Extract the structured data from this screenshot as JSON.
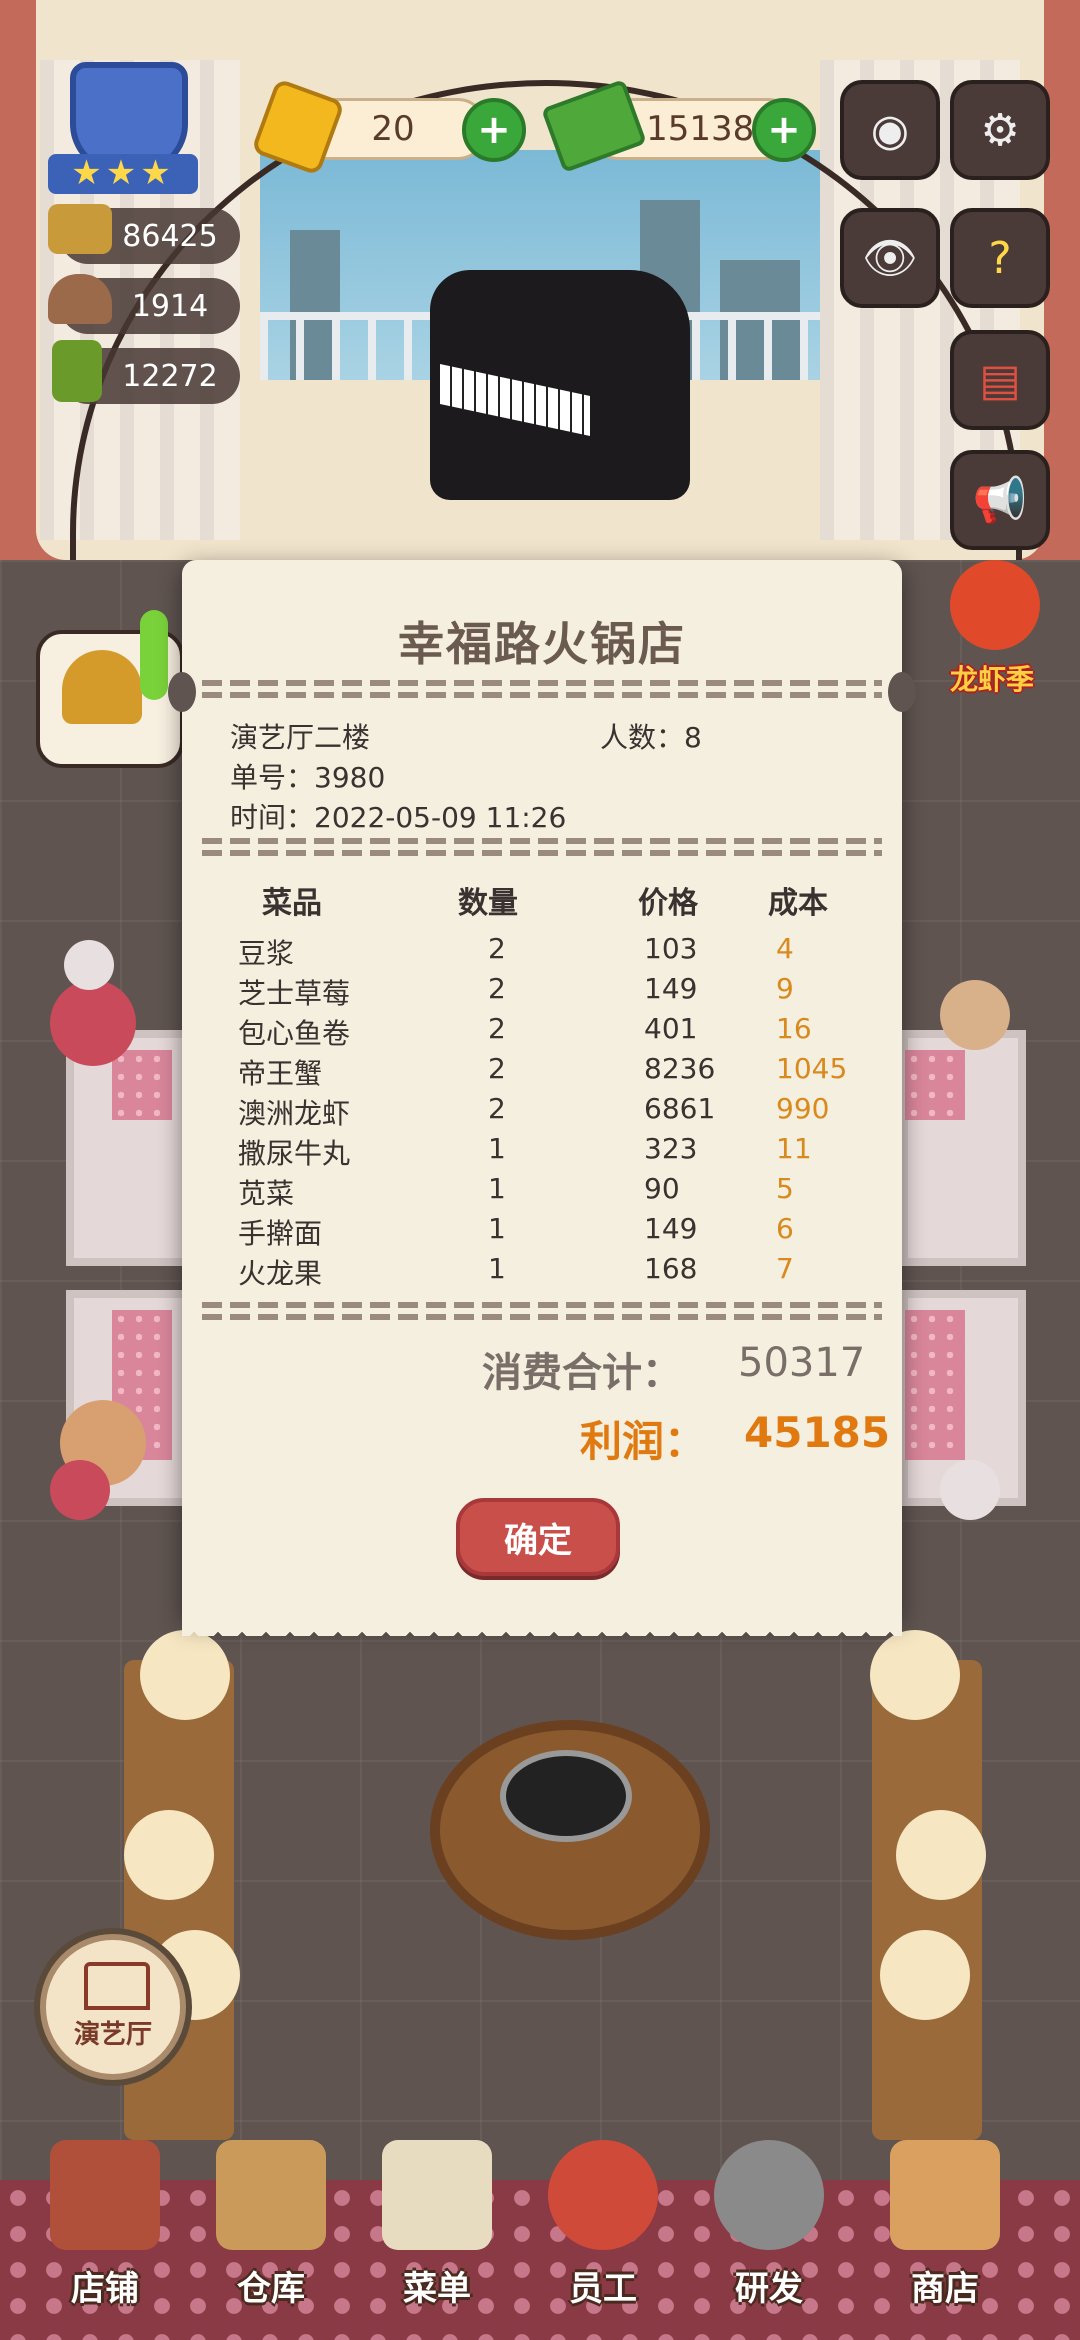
{
  "hud": {
    "gems": "20",
    "cash": "151382",
    "stat1": "86425",
    "stat2": "1914",
    "stat3": "12272",
    "stars": "★★★"
  },
  "side": {
    "event_label": "龙虾季"
  },
  "receipt": {
    "title": "幸福路火锅店",
    "hall": "演艺厅二楼",
    "people": "人数：8",
    "order_no": "单号：3980",
    "time": "时间：2022-05-09 11:26",
    "headers": {
      "name": "菜品",
      "qty": "数量",
      "price": "价格",
      "cost": "成本"
    },
    "items": [
      {
        "name": "豆浆",
        "qty": "2",
        "price": "103",
        "cost": "4"
      },
      {
        "name": "芝士草莓",
        "qty": "2",
        "price": "149",
        "cost": "9"
      },
      {
        "name": "包心鱼卷",
        "qty": "2",
        "price": "401",
        "cost": "16"
      },
      {
        "name": "帝王蟹",
        "qty": "2",
        "price": "8236",
        "cost": "1045"
      },
      {
        "name": "澳洲龙虾",
        "qty": "2",
        "price": "6861",
        "cost": "990"
      },
      {
        "name": "撒尿牛丸",
        "qty": "1",
        "price": "323",
        "cost": "11"
      },
      {
        "name": "苋菜",
        "qty": "1",
        "price": "90",
        "cost": "5"
      },
      {
        "name": "手擀面",
        "qty": "1",
        "price": "149",
        "cost": "6"
      },
      {
        "name": "火龙果",
        "qty": "1",
        "price": "168",
        "cost": "7"
      }
    ],
    "total_label": "消费合计：",
    "total_value": "50317",
    "profit_label": "利润：",
    "profit_value": "45185",
    "confirm": "确定"
  },
  "hall_button": "演艺厅",
  "nav": [
    {
      "label": "店铺",
      "color": "#b0503a"
    },
    {
      "label": "仓库",
      "color": "#c99a5a"
    },
    {
      "label": "菜单",
      "color": "#e8dcc0"
    },
    {
      "label": "员工",
      "color": "#d04a3a"
    },
    {
      "label": "研发",
      "color": "#8a8a8a"
    },
    {
      "label": "商店",
      "color": "#d9a060"
    }
  ],
  "colors": {
    "profit": "#e07a10",
    "cost": "#d98a1e",
    "confirm_button": "#c9504a"
  }
}
